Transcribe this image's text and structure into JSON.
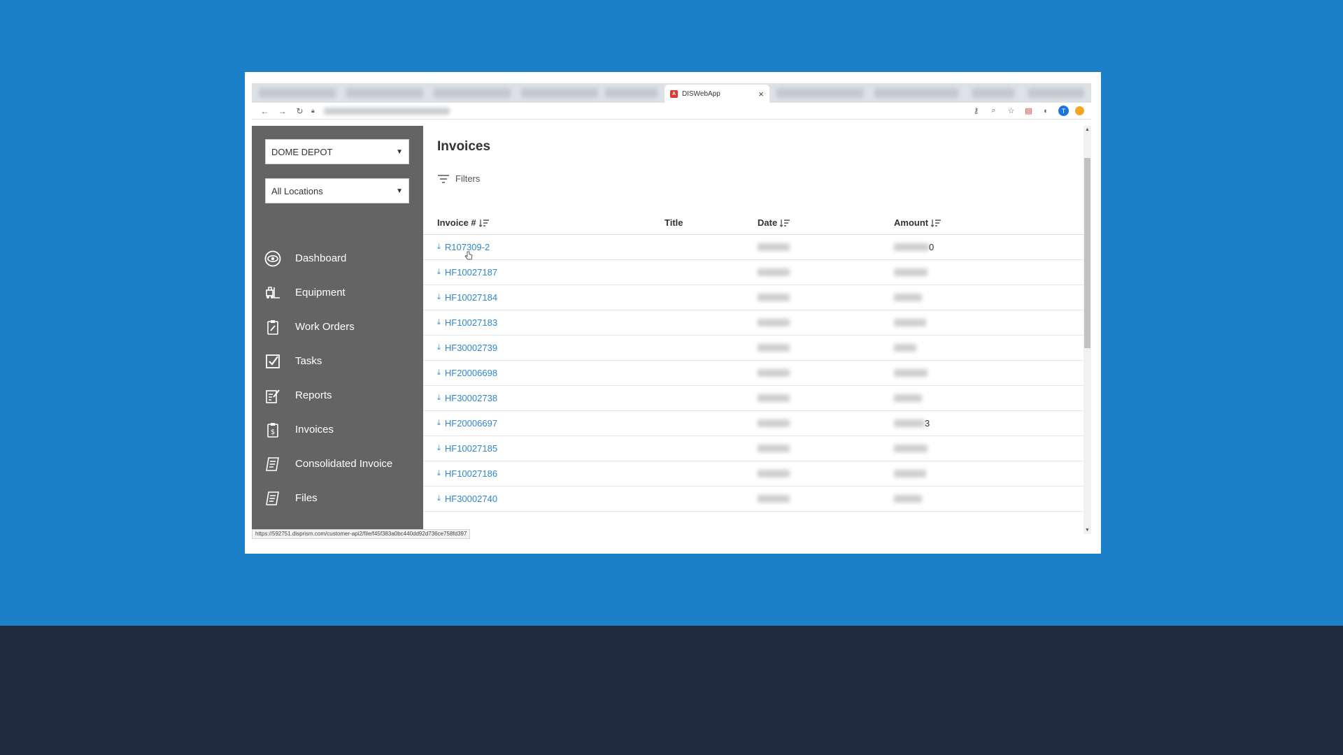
{
  "browser": {
    "active_tab_title": "DISWebApp",
    "tab_close": "×",
    "status_url": "https://592751.disprism.com/customer-api2/file/f45f383a0bc440dd92d736ce758fd397"
  },
  "sidebar": {
    "company_select": "DOME DEPOT",
    "location_select": "All Locations",
    "items": [
      {
        "label": "Dashboard",
        "icon": "eye-icon"
      },
      {
        "label": "Equipment",
        "icon": "forklift-icon"
      },
      {
        "label": "Work Orders",
        "icon": "clipboard-wrench-icon"
      },
      {
        "label": "Tasks",
        "icon": "checkbox-icon"
      },
      {
        "label": "Reports",
        "icon": "report-edit-icon"
      },
      {
        "label": "Invoices",
        "icon": "invoice-dollar-icon"
      },
      {
        "label": "Consolidated Invoice",
        "icon": "receipt-icon"
      },
      {
        "label": "Files",
        "icon": "files-icon"
      }
    ]
  },
  "main": {
    "title": "Invoices",
    "filters_label": "Filters",
    "columns": {
      "invoice": "Invoice #",
      "title": "Title",
      "date": "Date",
      "amount": "Amount"
    },
    "rows": [
      {
        "invoice": "R107309-2",
        "amount_tail": "0"
      },
      {
        "invoice": "HF10027187",
        "amount_tail": ""
      },
      {
        "invoice": "HF10027184",
        "amount_tail": ""
      },
      {
        "invoice": "HF10027183",
        "amount_tail": ""
      },
      {
        "invoice": "HF30002739",
        "amount_tail": ""
      },
      {
        "invoice": "HF20006698",
        "amount_tail": ""
      },
      {
        "invoice": "HF30002738",
        "amount_tail": ""
      },
      {
        "invoice": "HF20006697",
        "amount_tail": "3"
      },
      {
        "invoice": "HF10027185",
        "amount_tail": ""
      },
      {
        "invoice": "HF10027186",
        "amount_tail": ""
      },
      {
        "invoice": "HF30002740",
        "amount_tail": ""
      }
    ]
  },
  "colors": {
    "background": "#1b80c8",
    "bottom_band": "#212b40",
    "sidebar": "#646464",
    "link": "#2f86d4"
  }
}
